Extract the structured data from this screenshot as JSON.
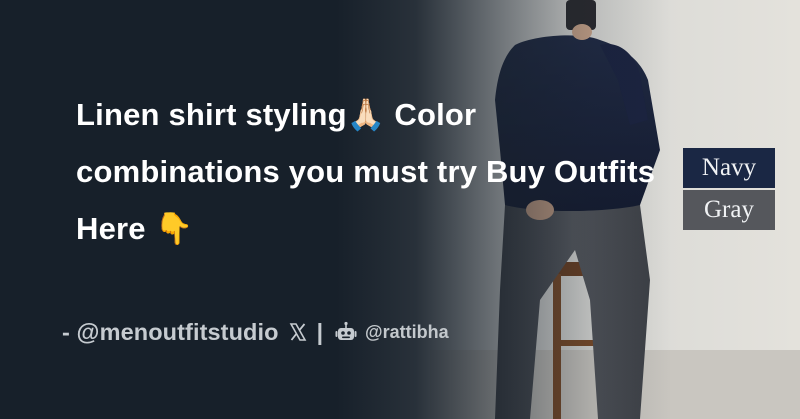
{
  "headline": "Linen shirt styling🙏🏻 Color combinations you must try Buy Outfits Here 👇",
  "author": "- @menoutfitstudio",
  "x_icon": "x-logo-icon",
  "separator": "|",
  "bot_icon": "robot-icon",
  "site_handle": "@rattibha",
  "color_swatches": [
    {
      "label": "Navy",
      "color": "#1a2744"
    },
    {
      "label": "Gray",
      "color": "#55575c"
    }
  ],
  "colors": {
    "background": "#17202a",
    "text": "#ffffff",
    "muted_text": "#c6cbd0"
  }
}
